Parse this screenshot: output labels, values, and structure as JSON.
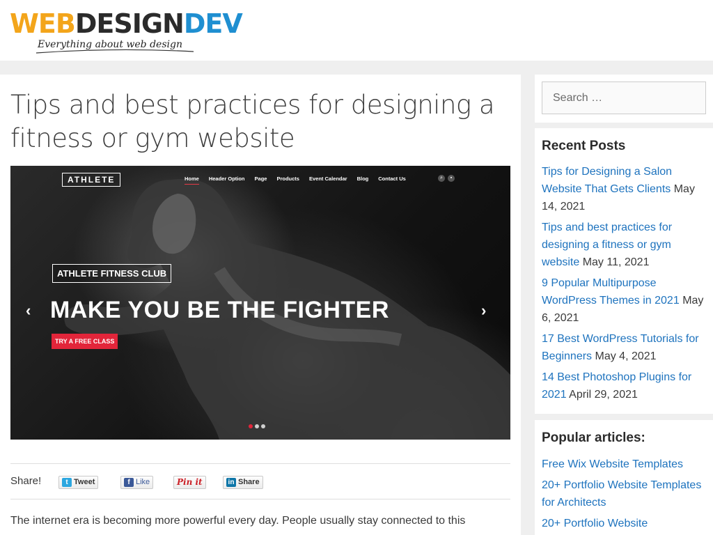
{
  "header": {
    "logo_web": "WEB",
    "logo_design": "DESIGN",
    "logo_dev": "DEV",
    "tagline": "Everything about web design"
  },
  "article": {
    "title": "Tips and best practices for designing a fitness or gym website",
    "hero": {
      "brand": "ATHLETE",
      "nav": [
        "Home",
        "Header Option",
        "Page",
        "Products",
        "Event Calendar",
        "Blog",
        "Contact Us"
      ],
      "club": "ATHLETE FITNESS CLUB",
      "headline": "MAKE YOU BE THE FIGHTER",
      "cta": "TRY A FREE CLASS",
      "prev": "‹",
      "next": "›"
    },
    "share": {
      "label": "Share!",
      "tweet": "Tweet",
      "like": "Like",
      "pinit": "Pin it",
      "linkedin": "Share"
    },
    "intro": "The internet era is becoming more powerful every day. People usually stay connected to this"
  },
  "sidebar": {
    "search_placeholder": "Search …",
    "recent": {
      "title": "Recent Posts",
      "posts": [
        {
          "title": "Tips for Designing a Salon Website That Gets Clients",
          "date": "May 14, 2021"
        },
        {
          "title": "Tips and best practices for designing a fitness or gym website",
          "date": "May 11, 2021"
        },
        {
          "title": "9 Popular Multipurpose WordPress Themes in 2021",
          "date": "May 6, 2021"
        },
        {
          "title": "17 Best WordPress Tutorials for Beginners",
          "date": "May 4, 2021"
        },
        {
          "title": "14 Best Photoshop Plugins for 2021",
          "date": "April 29, 2021"
        }
      ]
    },
    "popular": {
      "title": "Popular articles:",
      "items": [
        "Free Wix Website Templates",
        "20+ Portfolio Website Templates for Architects",
        "20+ Portfolio Website"
      ]
    }
  },
  "colors": {
    "link": "#1e73be",
    "cta": "#e2253a",
    "logo_orange": "#f3a51b",
    "logo_green": "#6ab42d",
    "logo_blue": "#1f8fd1"
  }
}
